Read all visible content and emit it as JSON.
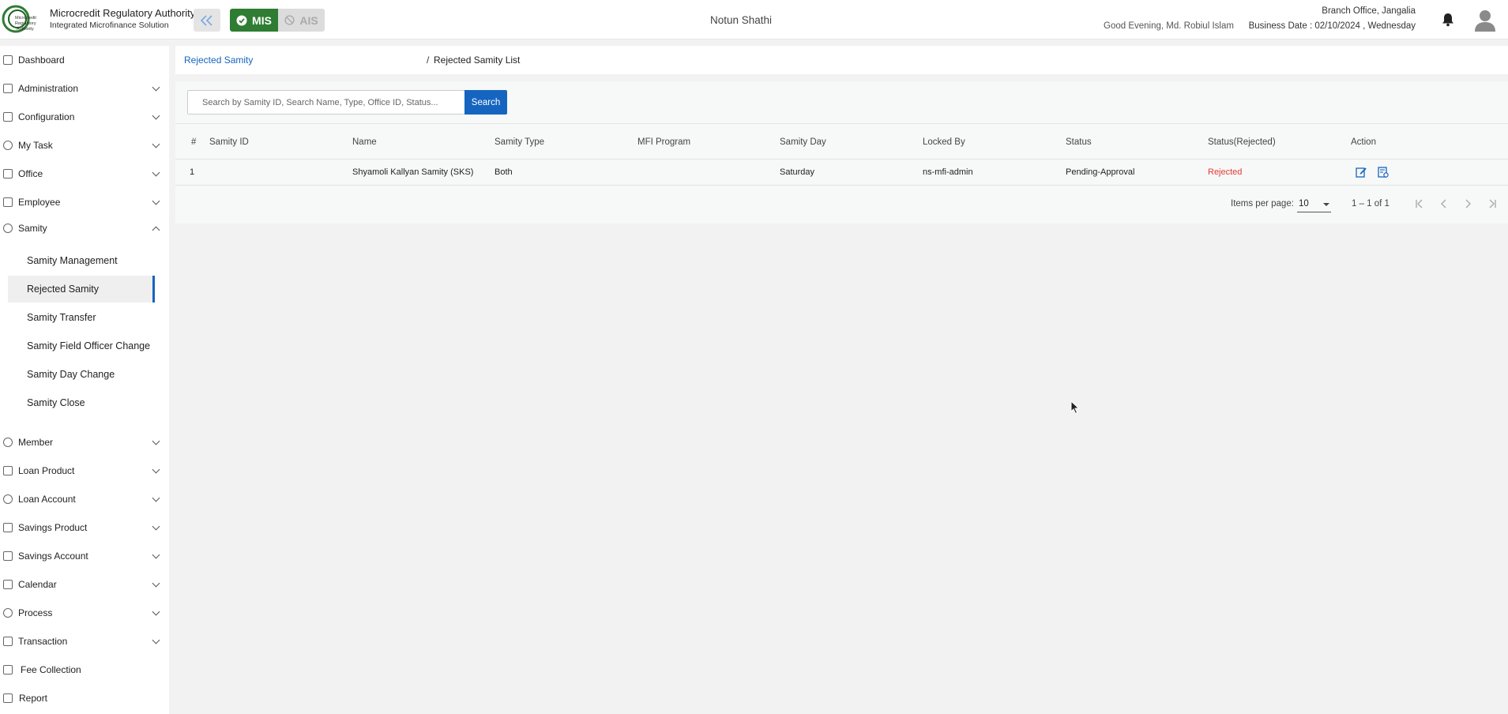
{
  "header": {
    "org_name": "Microcredit Regulatory Authority",
    "org_sub": "Integrated Microfinance Solution",
    "logo_text": "Microcredit Regulatory Authority",
    "mis_label": "MIS",
    "ais_label": "AIS",
    "app_name": "Notun Shathi",
    "greeting": "Good Evening, Md. Robiul Islam",
    "branch": "Branch Office, Jangalia",
    "business_date": "Business Date : 02/10/2024 , Wednesday"
  },
  "sidebar": {
    "items": [
      {
        "label": "Dashboard",
        "icon": "grid-icon"
      },
      {
        "label": "Administration",
        "icon": "admin-icon"
      },
      {
        "label": "Configuration",
        "icon": "sliders-icon"
      },
      {
        "label": "My Task",
        "icon": "task-icon"
      },
      {
        "label": "Office",
        "icon": "office-icon"
      },
      {
        "label": "Employee",
        "icon": "employee-icon"
      },
      {
        "label": "Samity",
        "icon": "samity-icon"
      }
    ],
    "samity_sub": [
      {
        "label": "Samity Management"
      },
      {
        "label": "Rejected Samity"
      },
      {
        "label": "Samity Transfer"
      },
      {
        "label": "Samity Field Officer Change"
      },
      {
        "label": "Samity Day Change"
      },
      {
        "label": "Samity Close"
      }
    ],
    "items_after": [
      {
        "label": "Member"
      },
      {
        "label": "Loan Product"
      },
      {
        "label": "Loan Account"
      },
      {
        "label": "Savings Product"
      },
      {
        "label": "Savings Account"
      },
      {
        "label": "Calendar"
      },
      {
        "label": "Process"
      },
      {
        "label": "Transaction"
      },
      {
        "label": "Fee Collection"
      },
      {
        "label": "Report"
      }
    ]
  },
  "breadcrumb": {
    "link": "Rejected Samity",
    "separator": "/",
    "current": "Rejected Samity List"
  },
  "search": {
    "placeholder": "Search by Samity ID, Search Name, Type, Office ID, Status...",
    "button": "Search"
  },
  "table": {
    "columns": [
      "#",
      "Samity ID",
      "Name",
      "Samity Type",
      "MFI Program",
      "Samity Day",
      "Locked By",
      "Status",
      "Status(Rejected)",
      "Action"
    ],
    "rows": [
      {
        "num": "1",
        "samity_id": "",
        "name": "Shyamoli Kallyan Samity (SKS)",
        "type": "Both",
        "mfi_program": "",
        "day": "Saturday",
        "locked_by": "ns-mfi-admin",
        "status": "Pending-Approval",
        "status_rejected": "Rejected"
      }
    ]
  },
  "pager": {
    "items_per_page_label": "Items per page:",
    "items_per_page": "10",
    "range": "1 – 1 of 1"
  },
  "colors": {
    "primary": "#1565c0",
    "mis_green": "#2e7d32",
    "rejected_red": "#e53935"
  }
}
